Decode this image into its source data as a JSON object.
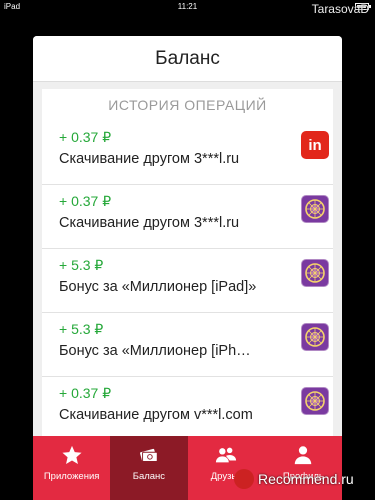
{
  "status_bar": {
    "device": "iPad",
    "time": "11:21"
  },
  "watermark": {
    "top": "TarasovaD",
    "bottom": "Recommend.ru"
  },
  "header": {
    "title": "Баланс"
  },
  "history": {
    "title": "ИСТОРИЯ ОПЕРАЦИЙ",
    "operations": [
      {
        "amount": "+ 0.37 ₽",
        "description": "Скачивание другом 3***l.ru",
        "icon": "linkedin-in-icon"
      },
      {
        "amount": "+ 0.37 ₽",
        "description": "Скачивание другом 3***l.ru",
        "icon": "millionaire-quiz-icon"
      },
      {
        "amount": "+ 5.3 ₽",
        "description": "Бонус за «Миллионер [iPad]»",
        "icon": "millionaire-quiz-icon"
      },
      {
        "amount": "+ 5.3 ₽",
        "description": "Бонус за «Миллионер [iPh…",
        "icon": "millionaire-quiz-icon"
      },
      {
        "amount": "+ 0.37 ₽",
        "description": "Скачивание другом v***l.com",
        "icon": "millionaire-quiz-icon"
      }
    ]
  },
  "tabs": [
    {
      "label": "Приложения",
      "icon": "star-icon",
      "active": false
    },
    {
      "label": "Баланс",
      "icon": "money-icon",
      "active": true
    },
    {
      "label": "Друзья",
      "icon": "friends-icon",
      "active": false
    },
    {
      "label": "Профиль",
      "icon": "profile-icon",
      "active": false
    }
  ],
  "colors": {
    "accent": "#e32a41",
    "active_tab": "#8c1a26",
    "amount": "#25a839"
  }
}
